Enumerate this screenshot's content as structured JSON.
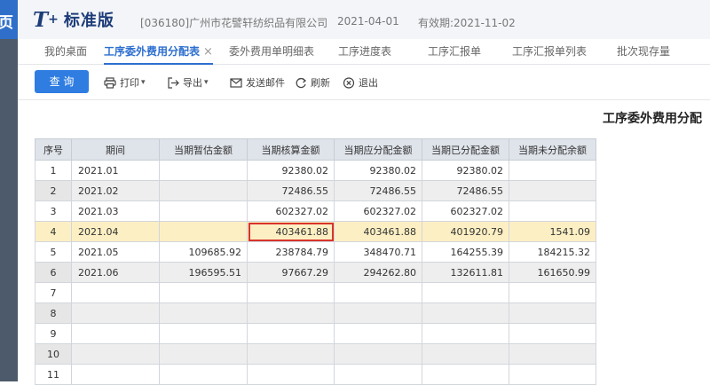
{
  "left_rail": {
    "glyph": "页"
  },
  "app": {
    "brand_logo": "T",
    "brand_plus": "+",
    "brand_edition": "标准版",
    "company": "[036180]广州市花譬轩纺织品有限公司",
    "period": "2021-04-01",
    "validity": "有效期:2021-11-02"
  },
  "tabs": [
    {
      "label": "我的桌面"
    },
    {
      "label": "工序委外费用分配表",
      "close": "×"
    },
    {
      "label": "委外费用单明细表"
    },
    {
      "label": "工序进度表"
    },
    {
      "label": "工序汇报单"
    },
    {
      "label": "工序汇报单列表"
    },
    {
      "label": "批次现存量"
    }
  ],
  "toolbar": {
    "query": "查 询",
    "print": "打印",
    "export": "导出",
    "email": "发送邮件",
    "refresh": "刷新",
    "exit": "退出",
    "print_icon": "printer-icon",
    "export_icon": "export-icon",
    "email_icon": "envelope-icon",
    "refresh_icon": "refresh-icon",
    "exit_icon": "close-circle-icon"
  },
  "report": {
    "title": "工序委外费用分配",
    "columns": [
      "序号",
      "期间",
      "当期暂估金额",
      "当期核算金额",
      "当期应分配金额",
      "当期已分配金额",
      "当期未分配余额"
    ],
    "rows": [
      [
        "1",
        "2021.01",
        "",
        "92380.02",
        "92380.02",
        "92380.02",
        ""
      ],
      [
        "2",
        "2021.02",
        "",
        "72486.55",
        "72486.55",
        "72486.55",
        ""
      ],
      [
        "3",
        "2021.03",
        "",
        "602327.02",
        "602327.02",
        "602327.02",
        ""
      ],
      [
        "4",
        "2021.04",
        "",
        "403461.88",
        "403461.88",
        "401920.79",
        "1541.09"
      ],
      [
        "5",
        "2021.05",
        "109685.92",
        "238784.79",
        "348470.71",
        "164255.39",
        "184215.32"
      ],
      [
        "6",
        "2021.06",
        "196595.51",
        "97667.29",
        "294262.80",
        "132611.81",
        "161650.99"
      ],
      [
        "7",
        "",
        "",
        "",
        "",
        "",
        ""
      ],
      [
        "8",
        "",
        "",
        "",
        "",
        "",
        ""
      ],
      [
        "9",
        "",
        "",
        "",
        "",
        "",
        ""
      ],
      [
        "10",
        "",
        "",
        "",
        "",
        "",
        ""
      ],
      [
        "11",
        "",
        "",
        "",
        "",
        "",
        ""
      ]
    ],
    "highlighted_row": 4,
    "focused_cell": {
      "row": 4,
      "column": "当期核算金额"
    },
    "highlight_color": "#fcefc3",
    "focus_border_color": "#d9342b"
  },
  "colors": {
    "accent": "#2f7de1",
    "brand": "#1d3c78",
    "active_tab": "#2e6fcf"
  }
}
